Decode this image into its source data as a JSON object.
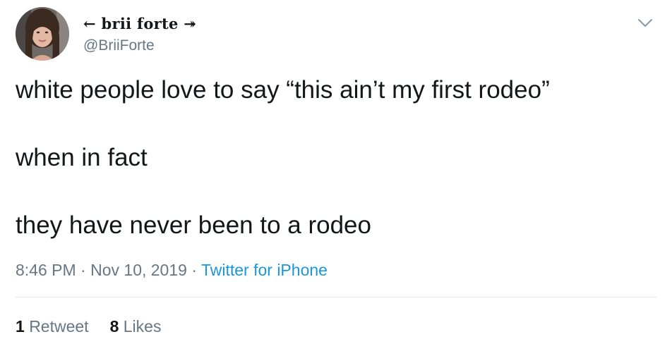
{
  "author": {
    "display_name": "← brii forte ↠",
    "handle": "@BriiForte"
  },
  "icons": {
    "avatar": "profile-photo",
    "caret": "chevron-down-icon"
  },
  "tweet": {
    "lines": [
      "white people love to say “this ain’t my first rodeo”",
      "when in fact",
      "they have never been to a rodeo"
    ]
  },
  "meta": {
    "time": "8:46 PM",
    "sep1": " · ",
    "date": "Nov 10, 2019",
    "sep2": " · ",
    "source": "Twitter for iPhone"
  },
  "stats": {
    "retweets_count": "1",
    "retweets_label": "Retweet",
    "likes_count": "8",
    "likes_label": "Likes"
  },
  "colors": {
    "text": "#14171a",
    "secondary": "#657786",
    "link": "#1b95e0",
    "divider": "#e1e8ed"
  }
}
